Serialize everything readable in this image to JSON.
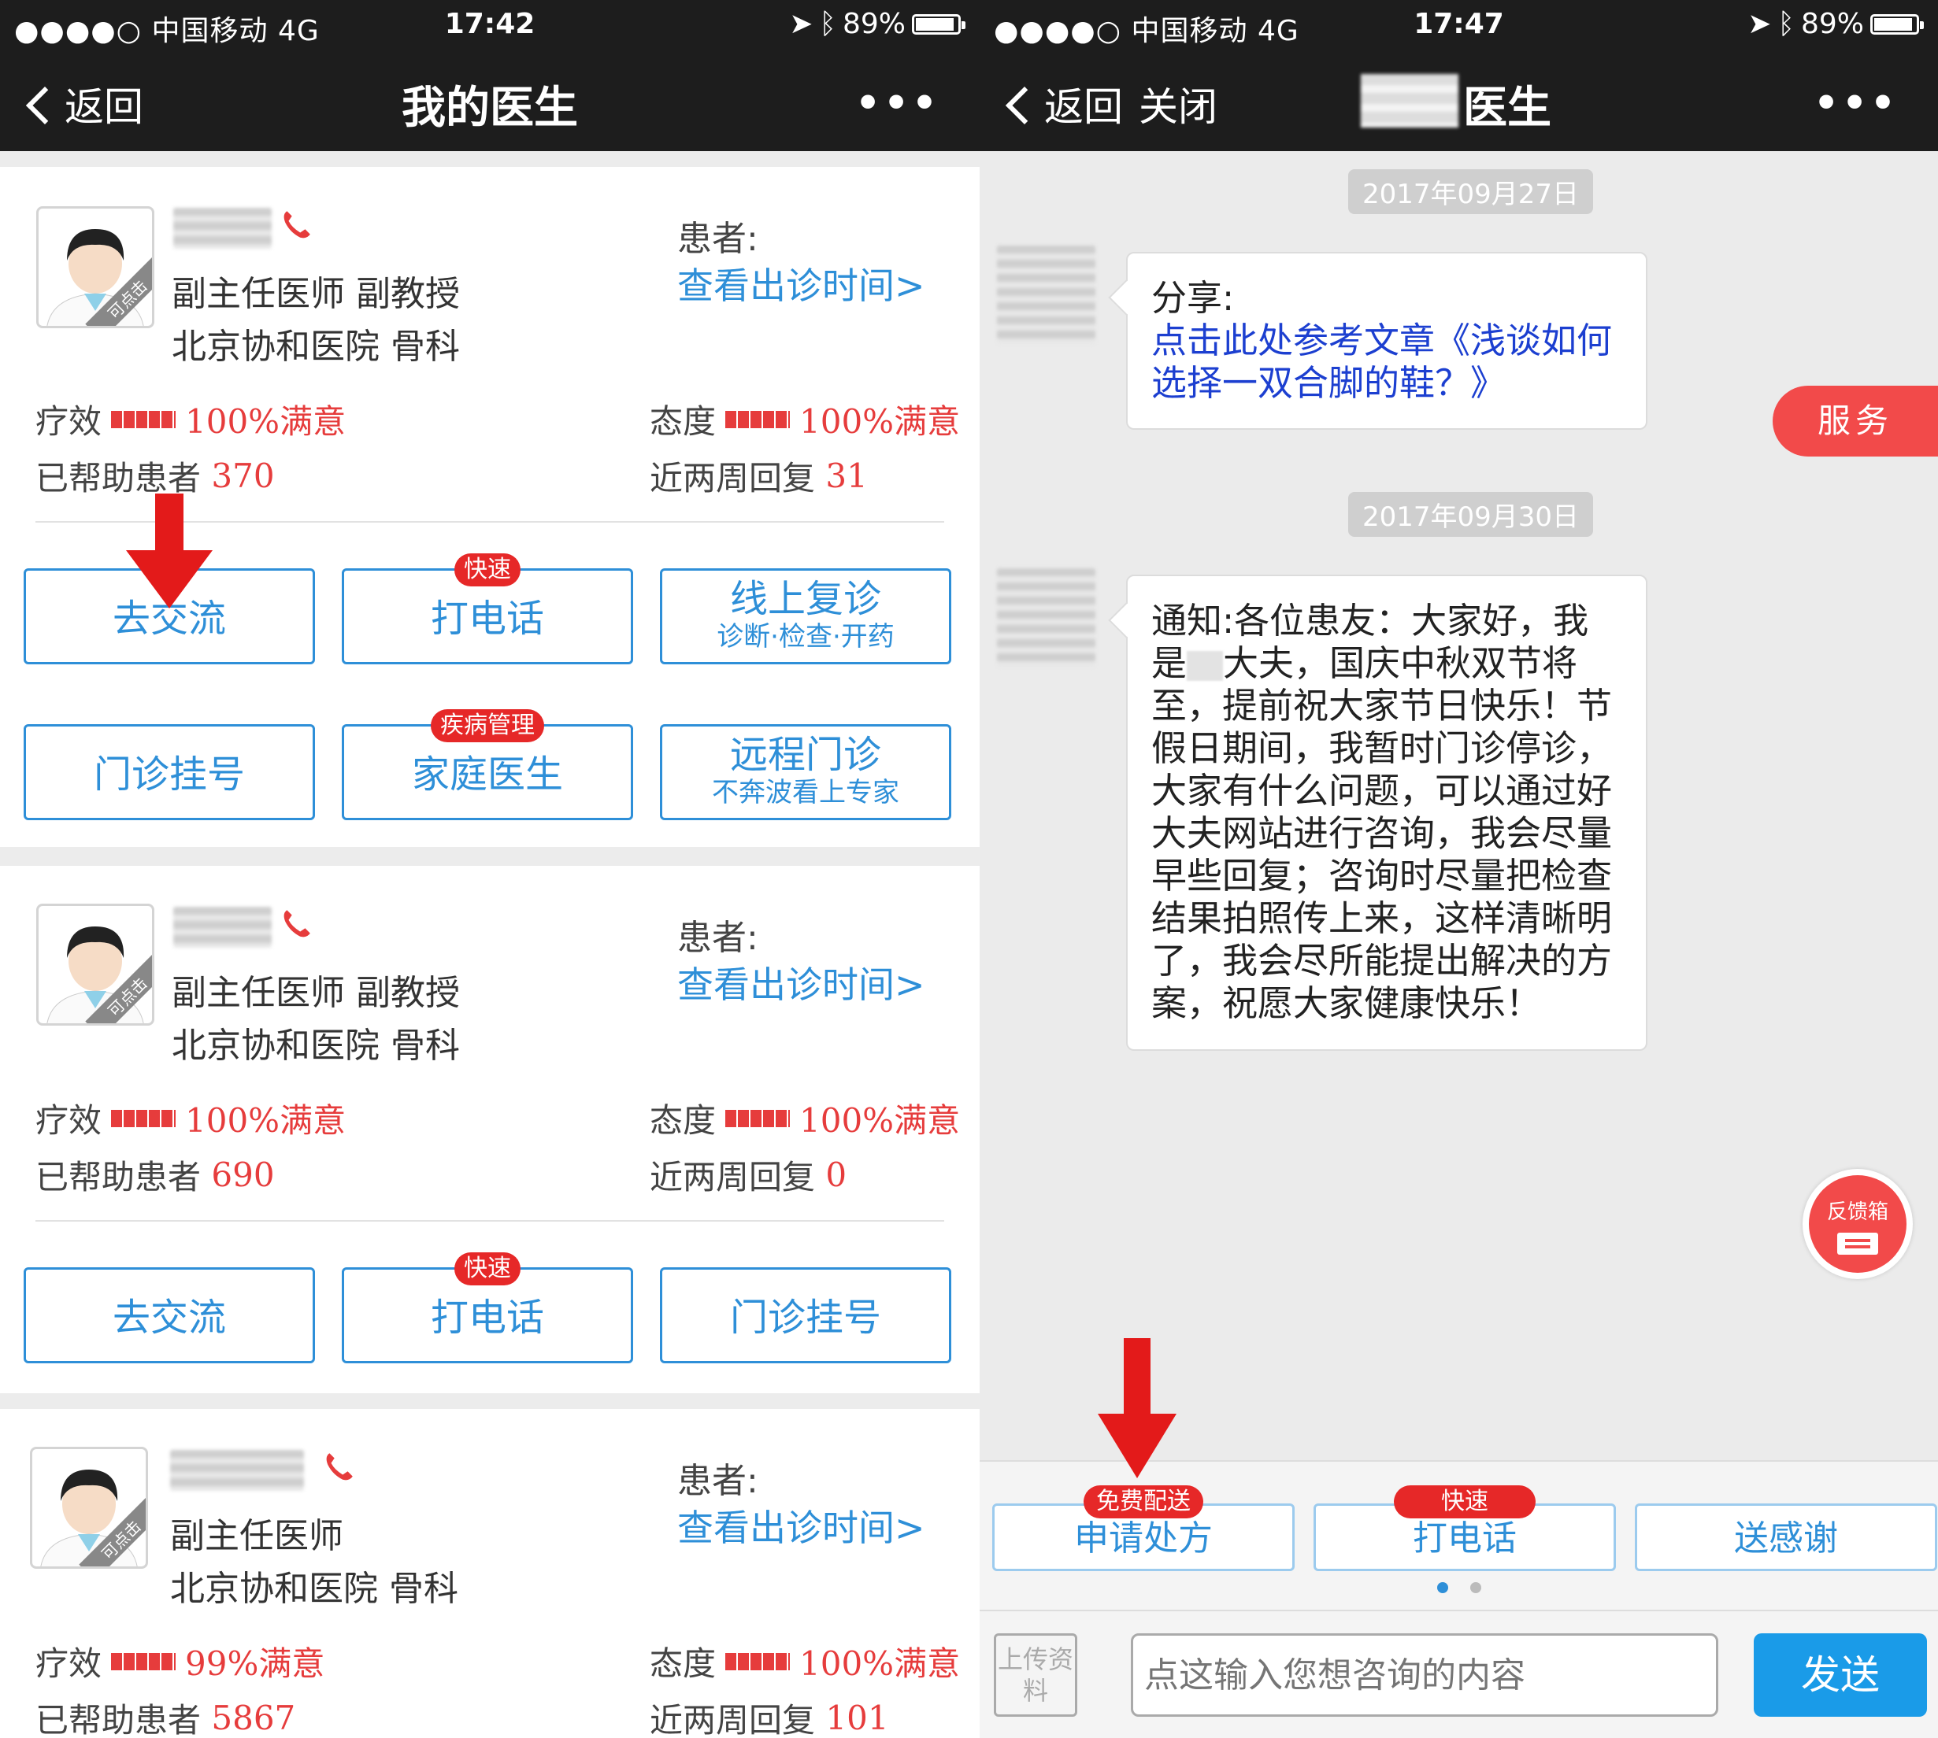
{
  "left": {
    "status": {
      "signal": "●●●●○ 中国移动  4G",
      "time": "17:42",
      "battery": "89%"
    },
    "nav": {
      "back": "返回",
      "title": "我的医生",
      "more": "•••"
    },
    "doctors": [
      {
        "avatar_tag": "可点击",
        "title": "副主任医师  副教授",
        "hospital": "北京协和医院 骨科",
        "patient_label": "患者:",
        "schedule_link": "查看出诊时间>",
        "efficacy_label": "疗效",
        "efficacy_value": "100%满意",
        "attitude_label": "态度",
        "attitude_value": "100%满意",
        "helped_label": "已帮助患者",
        "helped_value": "370",
        "replies_label": "近两周回复",
        "replies_value": "31",
        "buttons": [
          {
            "label": "去交流",
            "sub": "",
            "badge": ""
          },
          {
            "label": "打电话",
            "sub": "",
            "badge": "快速"
          },
          {
            "label": "线上复诊",
            "sub": "诊断·检查·开药",
            "badge": ""
          },
          {
            "label": "门诊挂号",
            "sub": "",
            "badge": ""
          },
          {
            "label": "家庭医生",
            "sub": "",
            "badge": "疾病管理"
          },
          {
            "label": "远程门诊",
            "sub": "不奔波看上专家",
            "badge": ""
          }
        ]
      },
      {
        "avatar_tag": "可点击",
        "title": "副主任医师  副教授",
        "hospital": "北京协和医院 骨科",
        "patient_label": "患者:",
        "schedule_link": "查看出诊时间>",
        "efficacy_label": "疗效",
        "efficacy_value": "100%满意",
        "attitude_label": "态度",
        "attitude_value": "100%满意",
        "helped_label": "已帮助患者",
        "helped_value": "690",
        "replies_label": "近两周回复",
        "replies_value": "0",
        "buttons": [
          {
            "label": "去交流",
            "sub": "",
            "badge": ""
          },
          {
            "label": "打电话",
            "sub": "",
            "badge": "快速"
          },
          {
            "label": "门诊挂号",
            "sub": "",
            "badge": ""
          }
        ]
      },
      {
        "avatar_tag": "可点击",
        "title": "副主任医师",
        "hospital": "北京协和医院 骨科",
        "patient_label": "患者:",
        "schedule_link": "查看出诊时间>",
        "efficacy_label": "疗效",
        "efficacy_value": "99%满意",
        "attitude_label": "态度",
        "attitude_value": "100%满意",
        "helped_label": "已帮助患者",
        "helped_value": "5867",
        "replies_label": "近两周回复",
        "replies_value": "101"
      }
    ]
  },
  "right": {
    "status": {
      "signal": "●●●●○ 中国移动  4G",
      "time": "17:47",
      "battery": "89%"
    },
    "nav": {
      "back": "返回",
      "close": "关闭",
      "title": "医生",
      "more": "•••"
    },
    "messages": [
      {
        "date": "2017年09月27日",
        "prefix": "分享:",
        "text": "点击此处参考文章《浅谈如何选择一双合脚的鞋？》"
      },
      {
        "date": "2017年09月30日",
        "text_a": "通知:各位患友：大家好，我是",
        "text_b": "大夫，国庆中秋双节将至，提前祝大家节日快乐！节假日期间，我暂时门诊停诊，大家有什么问题，可以通过好大夫网站进行咨询，我会尽量早些回复；咨询时尽量把检查结果拍照传上来，这样清晰明了，我会尽所能提出解决的方案，祝愿大家健康快乐！"
      }
    ],
    "service_tab": "服务",
    "feedback": "反馈箱",
    "quick_buttons": [
      {
        "label": "申请处方",
        "badge": "免费配送"
      },
      {
        "label": "打电话",
        "badge": "快速"
      },
      {
        "label": "送感谢",
        "badge": ""
      }
    ],
    "upload": "上传资料",
    "input_placeholder": "点这输入您想咨询的内容",
    "send": "发送"
  }
}
